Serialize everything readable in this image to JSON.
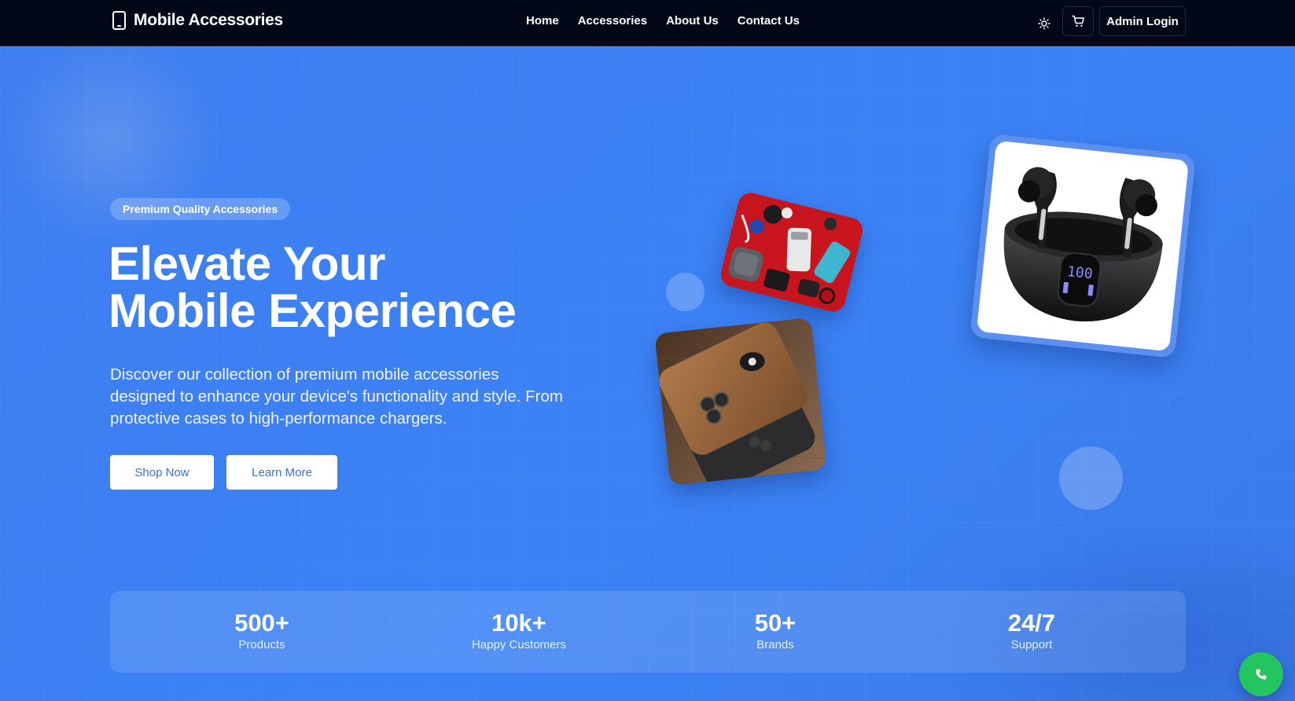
{
  "navbar": {
    "brand": "Mobile Accessories",
    "brand_icon": "smartphone-icon",
    "links": [
      "Home",
      "Accessories",
      "About Us",
      "Contact Us"
    ],
    "theme_icon": "sun-icon",
    "cart_icon": "shopping-cart-icon",
    "admin_label": "Admin Login"
  },
  "hero": {
    "badge": "Premium Quality Accessories",
    "headline_line1": "Elevate Your",
    "headline_line2": "Mobile Experience",
    "description": "Discover our collection of premium mobile accessories designed to enhance your device's functionality and style. From protective cases to high-performance chargers.",
    "shop_label": "Shop Now",
    "learn_label": "Learn More",
    "images": [
      "accessories-flatlay-image",
      "leather-phone-case-image",
      "wireless-earbuds-image"
    ]
  },
  "stats": [
    {
      "value": "500+",
      "label": "Products"
    },
    {
      "value": "10k+",
      "label": "Happy Customers"
    },
    {
      "value": "50+",
      "label": "Brands"
    },
    {
      "value": "24/7",
      "label": "Support"
    }
  ],
  "floating": {
    "call_icon": "phone-icon"
  },
  "colors": {
    "navbar_bg": "#020817",
    "hero_bg": "#3b82f6",
    "button_text": "#3b6fd8",
    "call_button": "#22c55e"
  }
}
